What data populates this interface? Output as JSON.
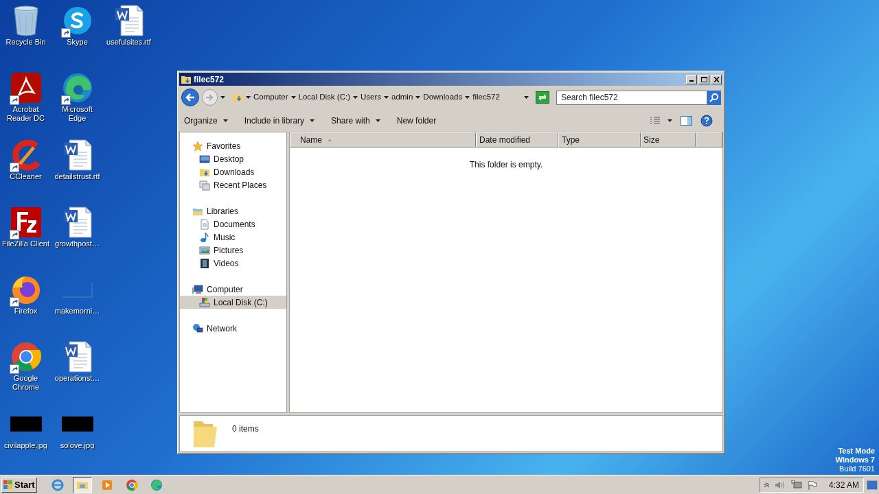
{
  "desktop": {
    "rows": [
      [
        {
          "label": "Recycle Bin",
          "kind": "recycle",
          "shortcut": false
        },
        {
          "label": "Skype",
          "kind": "skype",
          "shortcut": true
        },
        {
          "label": "usefulsites.rtf",
          "kind": "doc",
          "shortcut": false
        }
      ],
      [
        {
          "label": "Acrobat Reader DC",
          "kind": "acrobat",
          "shortcut": true
        },
        {
          "label": "Microsoft Edge",
          "kind": "edge",
          "shortcut": true
        }
      ],
      [
        {
          "label": "CCleaner",
          "kind": "ccleaner",
          "shortcut": true
        },
        {
          "label": "detailstrust.rtf",
          "kind": "doc",
          "shortcut": false
        }
      ],
      [
        {
          "label": "FileZilla Client",
          "kind": "filezilla",
          "shortcut": true
        },
        {
          "label": "growthpost…",
          "kind": "doc",
          "shortcut": false
        }
      ],
      [
        {
          "label": "Firefox",
          "kind": "firefox",
          "shortcut": true
        },
        {
          "label": "makemorni…",
          "kind": "blank",
          "shortcut": false
        }
      ],
      [
        {
          "label": "Google Chrome",
          "kind": "chrome",
          "shortcut": true
        },
        {
          "label": "operationst…",
          "kind": "doc",
          "shortcut": false
        }
      ],
      [
        {
          "label": "civilapple.jpg",
          "kind": "image",
          "shortcut": false
        },
        {
          "label": "solove.jpg",
          "kind": "image",
          "shortcut": false
        }
      ]
    ],
    "os_notice": [
      "Test Mode",
      "Windows 7",
      "Build 7601"
    ]
  },
  "window": {
    "title": "filec572",
    "breadcrumb": [
      "Computer",
      "Local Disk (C:)",
      "Users",
      "admin",
      "Downloads",
      "filec572"
    ],
    "search": {
      "placeholder": "Search filec572"
    },
    "toolbar": [
      {
        "label": "Organize",
        "dropdown": true
      },
      {
        "label": "Include in library",
        "dropdown": true
      },
      {
        "label": "Share with",
        "dropdown": true
      },
      {
        "label": "New folder",
        "dropdown": false
      }
    ],
    "nav": [
      {
        "label": "Favorites",
        "kind": "star",
        "selected": false,
        "children": [
          {
            "label": "Desktop",
            "kind": "desktop",
            "selected": false
          },
          {
            "label": "Downloads",
            "kind": "downloads",
            "selected": false
          },
          {
            "label": "Recent Places",
            "kind": "recent",
            "selected": false
          }
        ]
      },
      {
        "label": "Libraries",
        "kind": "library",
        "selected": false,
        "children": [
          {
            "label": "Documents",
            "kind": "documents",
            "selected": false
          },
          {
            "label": "Music",
            "kind": "music",
            "selected": false
          },
          {
            "label": "Pictures",
            "kind": "pictures",
            "selected": false
          },
          {
            "label": "Videos",
            "kind": "videos",
            "selected": false
          }
        ]
      },
      {
        "label": "Computer",
        "kind": "computer",
        "selected": false,
        "children": [
          {
            "label": "Local Disk (C:)",
            "kind": "disk",
            "selected": true
          }
        ]
      },
      {
        "label": "Network",
        "kind": "network",
        "selected": false
      }
    ],
    "columns": [
      {
        "label": "Name",
        "sorted": true
      },
      {
        "label": "Date modified",
        "sorted": false
      },
      {
        "label": "Type",
        "sorted": false
      },
      {
        "label": "Size",
        "sorted": false
      }
    ],
    "empty_message": "This folder is empty.",
    "details": "0 items"
  },
  "taskbar": {
    "start": "Start",
    "apps": [
      {
        "kind": "ie",
        "selected": false
      },
      {
        "kind": "explorer",
        "selected": true
      },
      {
        "kind": "media",
        "selected": false
      },
      {
        "kind": "chrome",
        "selected": false
      },
      {
        "kind": "edge",
        "selected": false
      }
    ],
    "time": "4:32 AM"
  }
}
